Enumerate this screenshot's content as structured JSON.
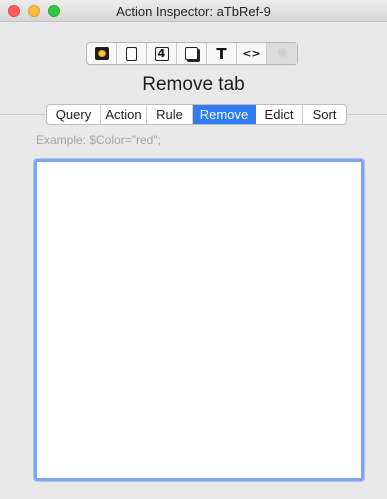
{
  "window": {
    "title": "Action Inspector: aTbRef-9"
  },
  "toolbar": {
    "buttons": [
      {
        "icon": "general-icon",
        "selected": false
      },
      {
        "icon": "appearance-icon",
        "selected": false
      },
      {
        "icon": "text-icon-numeral",
        "label": "4",
        "selected": false
      },
      {
        "icon": "shadow-icon",
        "selected": false
      },
      {
        "icon": "text-format-icon",
        "label": "T",
        "selected": false
      },
      {
        "icon": "code-icon",
        "label": "<>",
        "selected": false
      },
      {
        "icon": "gear-icon",
        "selected": true
      }
    ]
  },
  "heading": "Remove tab",
  "tabs": [
    {
      "label": "Query",
      "active": false
    },
    {
      "label": "Action",
      "active": false
    },
    {
      "label": "Rule",
      "active": false
    },
    {
      "label": "Remove",
      "active": true
    },
    {
      "label": "Edict",
      "active": false
    },
    {
      "label": "Sort",
      "active": false
    }
  ],
  "editor": {
    "placeholder": "Example: $Color=\"red\";",
    "value": ""
  },
  "colors": {
    "accent": "#2f7cf6",
    "focus_ring": "#7ba7ea",
    "close": "#fc605c",
    "minimize": "#fdbc40",
    "maximize": "#34c84a"
  }
}
